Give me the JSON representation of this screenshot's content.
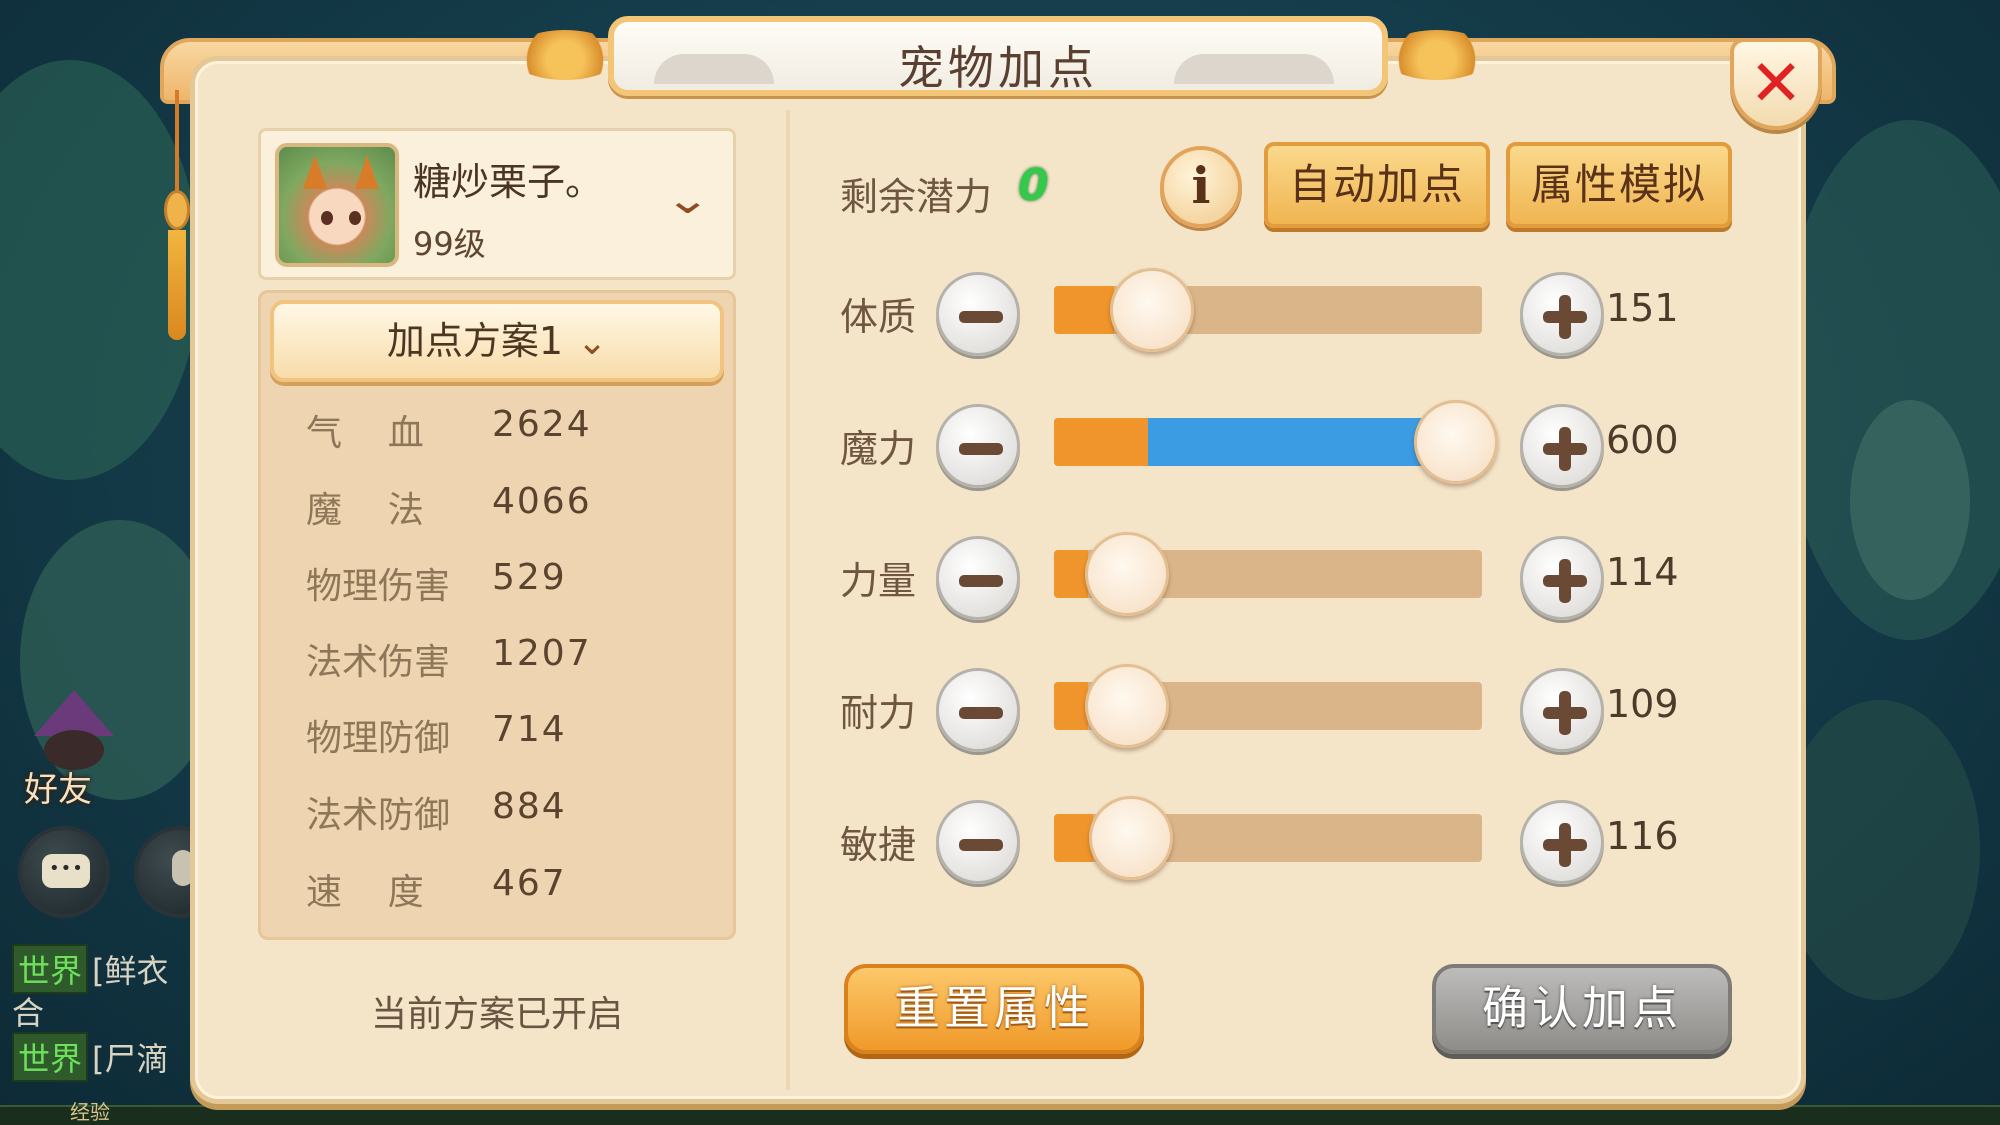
{
  "window": {
    "title": "宠物加点"
  },
  "hud": {
    "friends_label": "好友",
    "chat": [
      {
        "tag": "世界",
        "text": "[鲜衣"
      },
      {
        "tag": "",
        "text": "合"
      },
      {
        "tag": "世界",
        "text": "[尸滴"
      }
    ],
    "exp_label": "经验"
  },
  "pet": {
    "name": "糖炒栗子。",
    "level": "99级"
  },
  "plan": {
    "selected": "加点方案1",
    "status": "当前方案已开启"
  },
  "stats": [
    {
      "label": "气    血",
      "value": "2624"
    },
    {
      "label": "魔    法",
      "value": "4066"
    },
    {
      "label": "物理伤害",
      "value": "529"
    },
    {
      "label": "法术伤害",
      "value": "1207"
    },
    {
      "label": "物理防御",
      "value": "714"
    },
    {
      "label": "法术防御",
      "value": "884"
    },
    {
      "label": "速    度",
      "value": "467"
    }
  ],
  "potential": {
    "label": "剩余潜力",
    "value": "0"
  },
  "buttons": {
    "auto": "自动加点",
    "simulate": "属性模拟",
    "reset": "重置属性",
    "confirm": "确认加点"
  },
  "attributes": [
    {
      "key": "constitution",
      "label": "体质",
      "value": "151",
      "base_fraction": 0.14,
      "alloc_fraction": 0.0,
      "knob_fraction": 0.23
    },
    {
      "key": "magic",
      "label": "魔力",
      "value": "600",
      "base_fraction": 0.22,
      "alloc_fraction": 0.7,
      "knob_fraction": 0.94
    },
    {
      "key": "strength",
      "label": "力量",
      "value": "114",
      "base_fraction": 0.08,
      "alloc_fraction": 0.0,
      "knob_fraction": 0.17
    },
    {
      "key": "endurance",
      "label": "耐力",
      "value": "109",
      "base_fraction": 0.08,
      "alloc_fraction": 0.0,
      "knob_fraction": 0.17
    },
    {
      "key": "agility",
      "label": "敏捷",
      "value": "116",
      "base_fraction": 0.09,
      "alloc_fraction": 0.0,
      "knob_fraction": 0.18
    }
  ],
  "colors": {
    "panel": "#f4e4c8",
    "base_fill": "#f0952c",
    "alloc_fill": "#3b9be3",
    "potential": "#33c94a",
    "close": "#e12222"
  },
  "icons": {
    "close": "close-icon",
    "info": "info-icon",
    "minus": "minus-icon",
    "plus": "plus-icon",
    "chevron": "chevron-down-icon"
  }
}
